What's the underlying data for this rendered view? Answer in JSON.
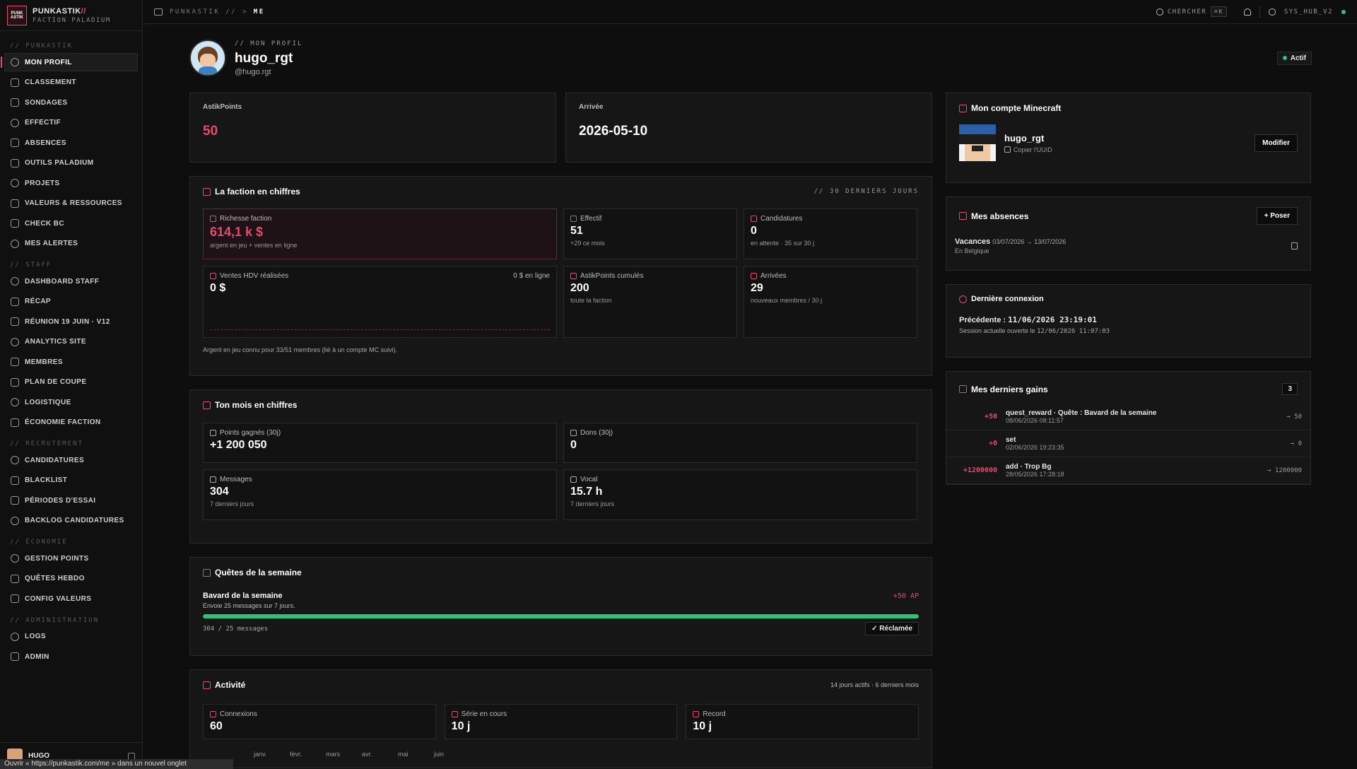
{
  "brand": {
    "logo": "PUNK ASTIK",
    "name": "PUNKASTIK",
    "name_accent": "//",
    "subtitle": "FACTION PALADIUM"
  },
  "sidebar": {
    "sections": [
      {
        "title": "// PUNKASTIK",
        "items": [
          "MON PROFIL",
          "CLASSEMENT",
          "SONDAGES",
          "EFFECTIF",
          "ABSENCES",
          "OUTILS PALADIUM",
          "PROJETS",
          "VALEURS & RESSOURCES",
          "CHECK BC",
          "MES ALERTES"
        ]
      },
      {
        "title": "// STAFF",
        "items": [
          "DASHBOARD STAFF",
          "RÉCAP",
          "RÉUNION 19 JUIN · V12",
          "ANALYTICS SITE",
          "MEMBRES",
          "PLAN DE COUPE",
          "LOGISTIQUE",
          "ÉCONOMIE FACTION"
        ]
      },
      {
        "title": "// RECRUTEMENT",
        "items": [
          "CANDIDATURES",
          "BLACKLIST",
          "PÉRIODES D'ESSAI",
          "BACKLOG CANDIDATURES"
        ]
      },
      {
        "title": "// ÉCONOMIE",
        "items": [
          "GESTION POINTS",
          "QUÊTES HEBDO",
          "CONFIG VALEURS"
        ]
      },
      {
        "title": "// ADMINISTRATION",
        "items": [
          "LOGS",
          "ADMIN"
        ]
      }
    ],
    "footer_user": "HUGO",
    "status_url": "Ouvrir « https://punkastik.com/me » dans un nouvel onglet"
  },
  "topbar": {
    "crumb_root": "PUNKASTIK //",
    "crumb_sep": ">",
    "crumb_current": "ME",
    "search": "CHERCHER",
    "shortcut": "⌘K",
    "hub": "SYS_HUB_V2"
  },
  "profile": {
    "section": "// MON PROFIL",
    "name": "hugo_rgt",
    "handle": "@hugo.rgt",
    "status": "Actif"
  },
  "stats": {
    "points_label": "AstikPoints",
    "points_value": "50",
    "arrival_label": "Arrivée",
    "arrival_value": "2026-05-10"
  },
  "faction": {
    "title": "La faction en chiffres",
    "period": "// 30 DERNIERS JOURS",
    "wealth_label": "Richesse faction",
    "wealth_value": "614,1 k $",
    "wealth_sub": "argent en jeu + ventes en ligne",
    "effectif_label": "Effectif",
    "effectif_value": "51",
    "effectif_sub": "+29 ce mois",
    "cand_label": "Candidatures",
    "cand_value": "0",
    "cand_sub": "en attente · 35 sur 30 j",
    "hdv_label": "Ventes HDV réalisées",
    "hdv_online": "0 $ en ligne",
    "hdv_value": "0 $",
    "ap_label": "AstikPoints cumulés",
    "ap_value": "200",
    "ap_sub": "toute la faction",
    "arr_label": "Arrivées",
    "arr_value": "29",
    "arr_sub": "nouveaux membres / 30 j",
    "note": "Argent en jeu connu pour 33/51 membres (lié à un compte MC suivi)."
  },
  "month": {
    "title": "Ton mois en chiffres",
    "pts_label": "Points gagnés (30j)",
    "pts_value": "+1 200 050",
    "dons_label": "Dons (30j)",
    "dons_value": "0",
    "msg_label": "Messages",
    "msg_value": "304",
    "msg_sub": "7 derniers jours",
    "vocal_label": "Vocal",
    "vocal_value": "15.7 h",
    "vocal_sub": "7 derniers jours"
  },
  "quests": {
    "title": "Quêtes de la semaine",
    "name": "Bavard de la semaine",
    "reward": "+50 AP",
    "desc": "Envoie 25 messages sur 7 jours.",
    "progress_text": "304 / 25 messages",
    "progress": 1.0,
    "claimed": "✓ Réclamée"
  },
  "activity": {
    "title": "Activité",
    "summary": "14 jours actifs · 6 derniers mois",
    "conn_label": "Connexions",
    "conn_value": "60",
    "streak_label": "Série en cours",
    "streak_value": "10 j",
    "record_label": "Record",
    "record_value": "10 j",
    "months": [
      "janv.",
      "févr.",
      "mars",
      "avr.",
      "mai",
      "juin"
    ]
  },
  "minecraft": {
    "title": "Mon compte Minecraft",
    "name": "hugo_rgt",
    "copy": "Copier l'UUID",
    "edit": "Modifier"
  },
  "absences": {
    "title": "Mes absences",
    "add": "Poser",
    "type": "Vacances",
    "range": "03/07/2026 → 13/07/2026",
    "place": "En Belgique"
  },
  "lastlogin": {
    "title": "Dernière connexion",
    "prev_label": "Précédente :",
    "prev_value": "11/06/2026 23:19:01",
    "session_label": "Session actuelle ouverte le",
    "session_value": "12/06/2026 11:07:03"
  },
  "gains": {
    "title": "Mes derniers gains",
    "count": "3",
    "items": [
      {
        "pts": "+50",
        "label": "quest_reward · Quête : Bavard de la semaine",
        "date": "08/06/2026 08:11:57",
        "total": "→ 50"
      },
      {
        "pts": "+0",
        "label": "set",
        "date": "02/06/2026 19:23:35",
        "total": "→ 0"
      },
      {
        "pts": "+1200000",
        "label": "add · Trop Bg",
        "date": "28/05/2026 17:28:18",
        "total": "→ 1200000"
      }
    ]
  },
  "colors": {
    "accent": "#e34b6f",
    "success": "#2ec27e",
    "bg": "#0e0e0e"
  }
}
